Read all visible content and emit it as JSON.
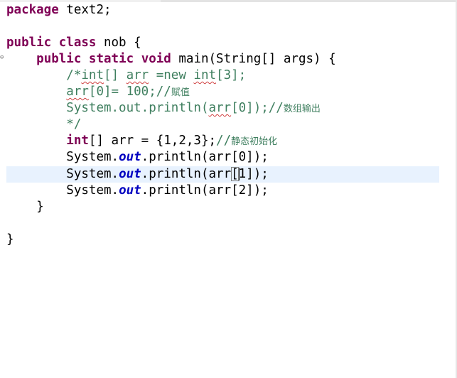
{
  "editor": {
    "lines": {
      "l1": {
        "kw": "package",
        "rest": " text2;"
      },
      "l3": {
        "kw1": "public",
        "kw2": "class",
        "rest": " nob {"
      },
      "l4": {
        "kw1": "public",
        "kw2": "static",
        "kw3": "void",
        "rest": " main(String[] args) {"
      },
      "l5": {
        "a": "/*",
        "b": "int",
        "c": "[] ",
        "d": "arr",
        "e": " =new ",
        "f": "int",
        "g": "[3];"
      },
      "l6": {
        "a": "arr",
        "b": "[0]= 100;//",
        "c": "赋值"
      },
      "l7": {
        "a": "System.out.println(",
        "b": "arr",
        "c": "[0]);//",
        "d": "数组输出"
      },
      "l8": {
        "a": "*/"
      },
      "l9": {
        "kw": "int",
        "a": "[] arr = {1,2,3};",
        "b": "//",
        "c": "静态初始化"
      },
      "l10": {
        "a": "System.",
        "b": "out",
        "c": ".println(arr[0]);"
      },
      "l11": {
        "a": "System.",
        "b": "out",
        "c": ".println(arr",
        "d": "[",
        "e": "1]);"
      },
      "l12": {
        "a": "System.",
        "b": "out",
        "c": ".println(arr[2]);"
      },
      "l13": {
        "a": "}"
      },
      "l15": {
        "a": "}"
      }
    },
    "fold_marker": "⊖"
  },
  "colors": {
    "keyword": "#7f0055",
    "comment": "#3f7f5f",
    "static_field": "#0000c0",
    "current_line": "#e8f2fe"
  }
}
